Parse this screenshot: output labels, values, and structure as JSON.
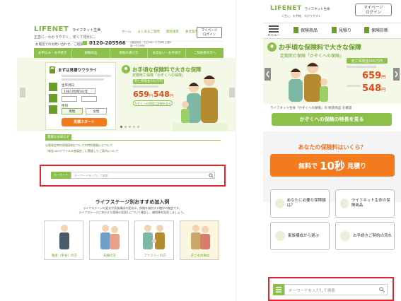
{
  "desktop": {
    "logo": "LIFENET",
    "logo_company": "ライフネット生命",
    "logo_tagline": "正直に、わかりやすく、安くて便利に。",
    "toplinks": [
      "ホーム",
      "よくあるご質問",
      "資料請求",
      "会社案内"
    ],
    "mypage_button": "マイページ\nログイン",
    "contact_label": "お電話でのお問い合わせ、ご相談",
    "phone": "0120-205566",
    "phone_hours": "(通話無料／平日9時〜夕方8時 土曜9時〜夕方6時)",
    "nav": [
      "お申込み・お手続き",
      "保険商品",
      "保険の選び方",
      "お支払い・お手続き",
      "ご契約者の方へ"
    ],
    "sim": {
      "title": "まずは見積りウラライ",
      "birthday_label": "生年月日",
      "birthday_value": "1981(昭和56)年",
      "gender_label": "性別",
      "gender_options": [
        "男性",
        "女性"
      ],
      "start_button": "見積スタート"
    },
    "hero": {
      "headline": "お手頃な保険料で大きな保障",
      "sub": "定期死亡保険「かぞくへの保険」",
      "badge": "死亡保険金500万円",
      "price1": "659",
      "price2": "548",
      "price_unit": "円",
      "price_cta": "かぞくへの保険の詳細を見る"
    },
    "news_header": "重要なお知らせ",
    "news_items": [
      "災害発生時の保険契約についての特別取扱いについて",
      "「新型コロナウイルス感染症」に関連したご案内について"
    ],
    "search": {
      "label": "キーワード",
      "placeholder": "キーワードを入力して検索"
    },
    "lifestage": {
      "title": "ライフステージ別おすすめ加入例",
      "desc": "ライフステージの変化や家族構成の変化は、保険を検討する絶好の機会です。\nライフステージに合わせた保障の見直しについて確認し、補保障を見直しましょう。",
      "cards": [
        "独身（単身）の方",
        "夫婦の方",
        "ファミリーの方",
        "子どもの独立"
      ]
    }
  },
  "mobile": {
    "logo": "LIFENET",
    "logo_company": "ライフネット生命",
    "logo_tagline": "人生に、お手軽、わかりやすく",
    "mypage_button": "マイページ\nログイン",
    "menu_label": "メニュー",
    "tabs": [
      "保険商品",
      "見積り",
      "保険診断"
    ],
    "hero": {
      "headline": "お手頃な保険料で大きな保障",
      "sub": "定期死亡保険「かぞくへの保険」",
      "badge": "死亡保険金500万円",
      "price1": "659",
      "price2": "548",
      "price_unit": "円",
      "note": "ライフネット生命「かぞくへの保険」の 販売商品 を確認",
      "cta": "かぞくへの保険の特長を見る"
    },
    "quote_question": "あなたの保険料はいくら？",
    "quote_button_pre": "無料で",
    "quote_button_big": "10秒",
    "quote_button_post": "見積り",
    "grid": [
      "あなたに必要な保障額は？",
      "ライフネット生命の保険商品",
      "家族構成から選ぶ",
      "お手続きご契約の流れ"
    ],
    "search_placeholder": "キーワードを入力して検索"
  },
  "colors": {
    "brand_green": "#8dc04a",
    "accent_orange": "#f47a20",
    "price_red": "#e64a19",
    "highlight_red": "#e5232a"
  }
}
